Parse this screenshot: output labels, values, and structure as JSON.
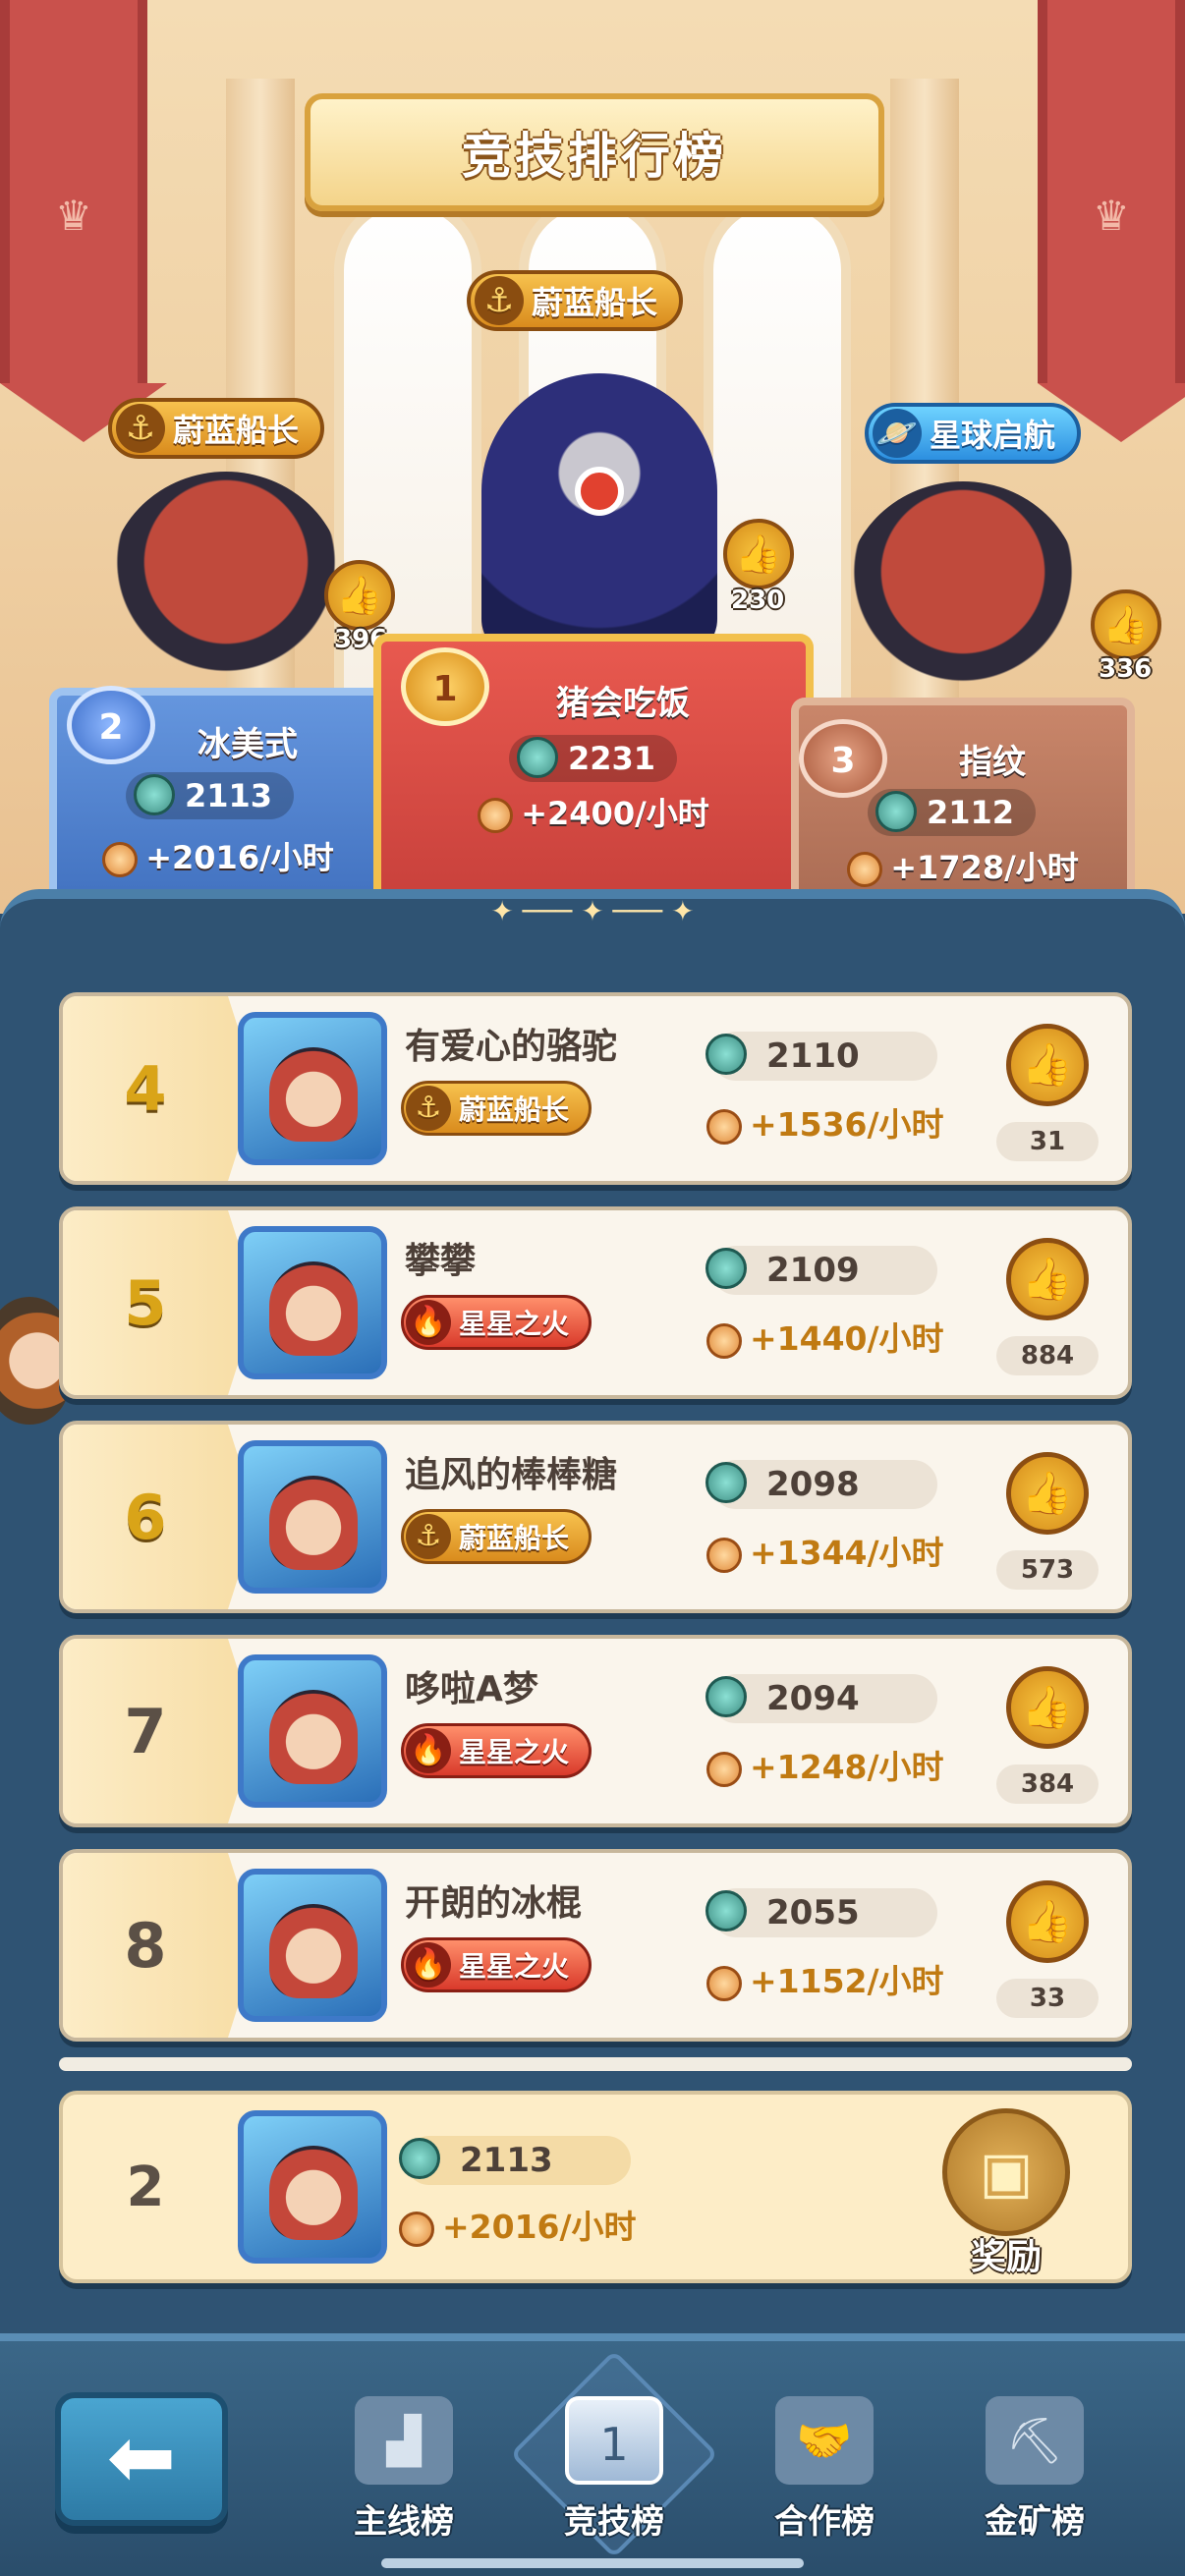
{
  "title": "竞技排行榜",
  "podium": {
    "first": {
      "rank": "1",
      "name": "猪会吃饭",
      "score": "2231",
      "rate": "+2400/小时",
      "likes": "230",
      "tag": "蔚蓝船长"
    },
    "second": {
      "rank": "2",
      "name": "冰美式",
      "score": "2113",
      "rate": "+2016/小时",
      "likes": "396",
      "tag": "蔚蓝船长"
    },
    "third": {
      "rank": "3",
      "name": "指纹",
      "score": "2112",
      "rate": "+1728/小时",
      "likes": "336",
      "tag": "星球启航"
    }
  },
  "rows": [
    {
      "rank": "4",
      "name": "有爱心的骆驼",
      "tag": "蔚蓝船长",
      "tag_type": "anchor",
      "score": "2110",
      "rate": "+1536/小时",
      "likes": "31"
    },
    {
      "rank": "5",
      "name": "攀攀",
      "tag": "星星之火",
      "tag_type": "fire",
      "score": "2109",
      "rate": "+1440/小时",
      "likes": "884"
    },
    {
      "rank": "6",
      "name": "追风的棒棒糖",
      "tag": "蔚蓝船长",
      "tag_type": "anchor",
      "score": "2098",
      "rate": "+1344/小时",
      "likes": "573"
    },
    {
      "rank": "7",
      "name": "哆啦A梦",
      "tag": "星星之火",
      "tag_type": "fire",
      "score": "2094",
      "rate": "+1248/小时",
      "likes": "384"
    },
    {
      "rank": "8",
      "name": "开朗的冰棍",
      "tag": "星星之火",
      "tag_type": "fire",
      "score": "2055",
      "rate": "+1152/小时",
      "likes": "33"
    }
  ],
  "self": {
    "rank": "2",
    "score": "2113",
    "rate": "+2016/小时",
    "reward_label": "奖励"
  },
  "nav": {
    "back_icon": "arrow-left-icon",
    "items": [
      {
        "label": "主线榜",
        "icon": "podium-icon"
      },
      {
        "label": "竞技榜",
        "icon": "podium-active-icon"
      },
      {
        "label": "合作榜",
        "icon": "handshake-icon"
      },
      {
        "label": "金矿榜",
        "icon": "mine-cart-icon"
      }
    ]
  },
  "colors": {
    "gold": "#d9a418",
    "rate": "#c07a12",
    "panel": "#2f5373",
    "first": "#c63f3a",
    "second": "#3f6fbe",
    "third": "#a86a52"
  }
}
